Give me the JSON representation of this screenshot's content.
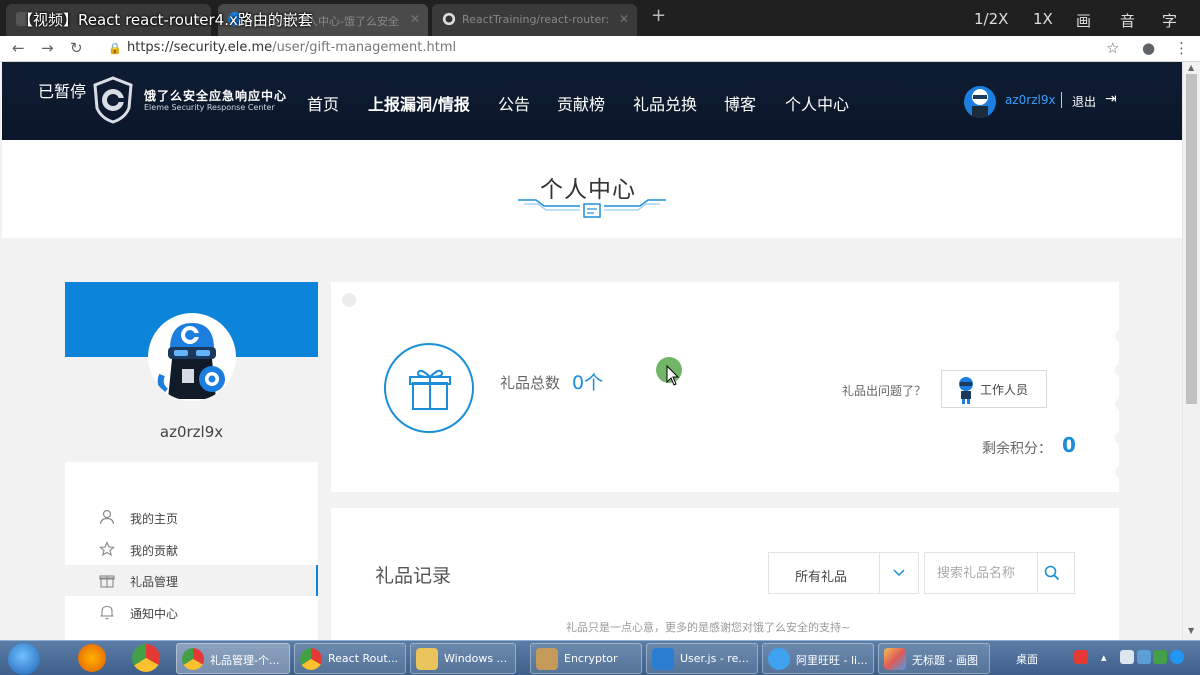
{
  "browser": {
    "tabs": [
      {
        "title": "React react-router4.x路由的嵌套"
      },
      {
        "title": "礼品管理-个人中心-饿了么安全"
      },
      {
        "title": "ReactTraining/react-router: De"
      }
    ],
    "video_title": "【视频】React  react-router4.x路由的嵌套",
    "video_controls": [
      "1/2X",
      "1X",
      "画",
      "音",
      "字"
    ],
    "url_host": "https://security.ele.me",
    "url_path": "/user/gift-management.html"
  },
  "site": {
    "paused_label": "已暂停",
    "logo_cn": "饿了么安全应急响应中心",
    "logo_en": "Eleme Security Response Center",
    "nav": [
      "首页",
      "上报漏洞/情报",
      "公告",
      "贡献榜",
      "礼品兑换",
      "博客",
      "个人中心"
    ],
    "username": "az0rzl9x",
    "logout": "退出"
  },
  "page": {
    "title": "个人中心"
  },
  "profile": {
    "username": "az0rzl9x",
    "menu": [
      {
        "label": "我的主页",
        "icon": "user-icon"
      },
      {
        "label": "我的贡献",
        "icon": "star-icon"
      },
      {
        "label": "礼品管理",
        "icon": "gift-icon",
        "active": true
      },
      {
        "label": "通知中心",
        "icon": "bell-icon"
      }
    ]
  },
  "gift_summary": {
    "total_label": "礼品总数",
    "total_value": "0个",
    "problem_text": "礼品出问题了？",
    "staff_button": "工作人员",
    "points_label": "剩余积分：",
    "points_value": "0"
  },
  "gift_record": {
    "title": "礼品记录",
    "filter_selected": "所有礼品",
    "search_placeholder": "搜索礼品名称",
    "thanks": "礼品只是一点心意，更多的是感谢您对饿了么安全的支持~"
  },
  "taskbar": {
    "items": [
      {
        "label": "礼品管理-个...",
        "active": true
      },
      {
        "label": "React Rout..."
      },
      {
        "label": "Windows ..."
      },
      {
        "label": "Encryptor"
      },
      {
        "label": "User.js - re..."
      },
      {
        "label": "阿里旺旺 - li..."
      },
      {
        "label": "无标题 - 画图"
      }
    ],
    "desktop_label": "桌面"
  },
  "colors": {
    "accent": "#1a8fd8",
    "nav_bg": "#0f1d33",
    "profile_blue": "#0b84d9"
  }
}
